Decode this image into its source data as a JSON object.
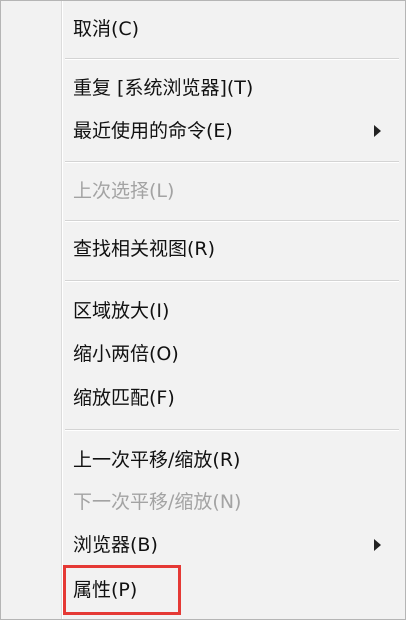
{
  "menu": {
    "items": [
      {
        "label": "取消(C)",
        "disabled": false,
        "submenu": false
      },
      {
        "label": "重复 [系统浏览器](T)",
        "disabled": false,
        "submenu": false
      },
      {
        "label": "最近使用的命令(E)",
        "disabled": false,
        "submenu": true
      },
      {
        "label": "上次选择(L)",
        "disabled": true,
        "submenu": false
      },
      {
        "label": "查找相关视图(R)",
        "disabled": false,
        "submenu": false
      },
      {
        "label": "区域放大(I)",
        "disabled": false,
        "submenu": false
      },
      {
        "label": "缩小两倍(O)",
        "disabled": false,
        "submenu": false
      },
      {
        "label": "缩放匹配(F)",
        "disabled": false,
        "submenu": false
      },
      {
        "label": "上一次平移/缩放(R)",
        "disabled": false,
        "submenu": false
      },
      {
        "label": "下一次平移/缩放(N)",
        "disabled": true,
        "submenu": false
      },
      {
        "label": "浏览器(B)",
        "disabled": false,
        "submenu": true
      },
      {
        "label": "属性(P)",
        "disabled": false,
        "submenu": false,
        "highlighted": true
      }
    ]
  },
  "colors": {
    "highlight_border": "#e53935",
    "disabled_text": "#a3a3a3",
    "menu_background": "#f2f2f2"
  }
}
